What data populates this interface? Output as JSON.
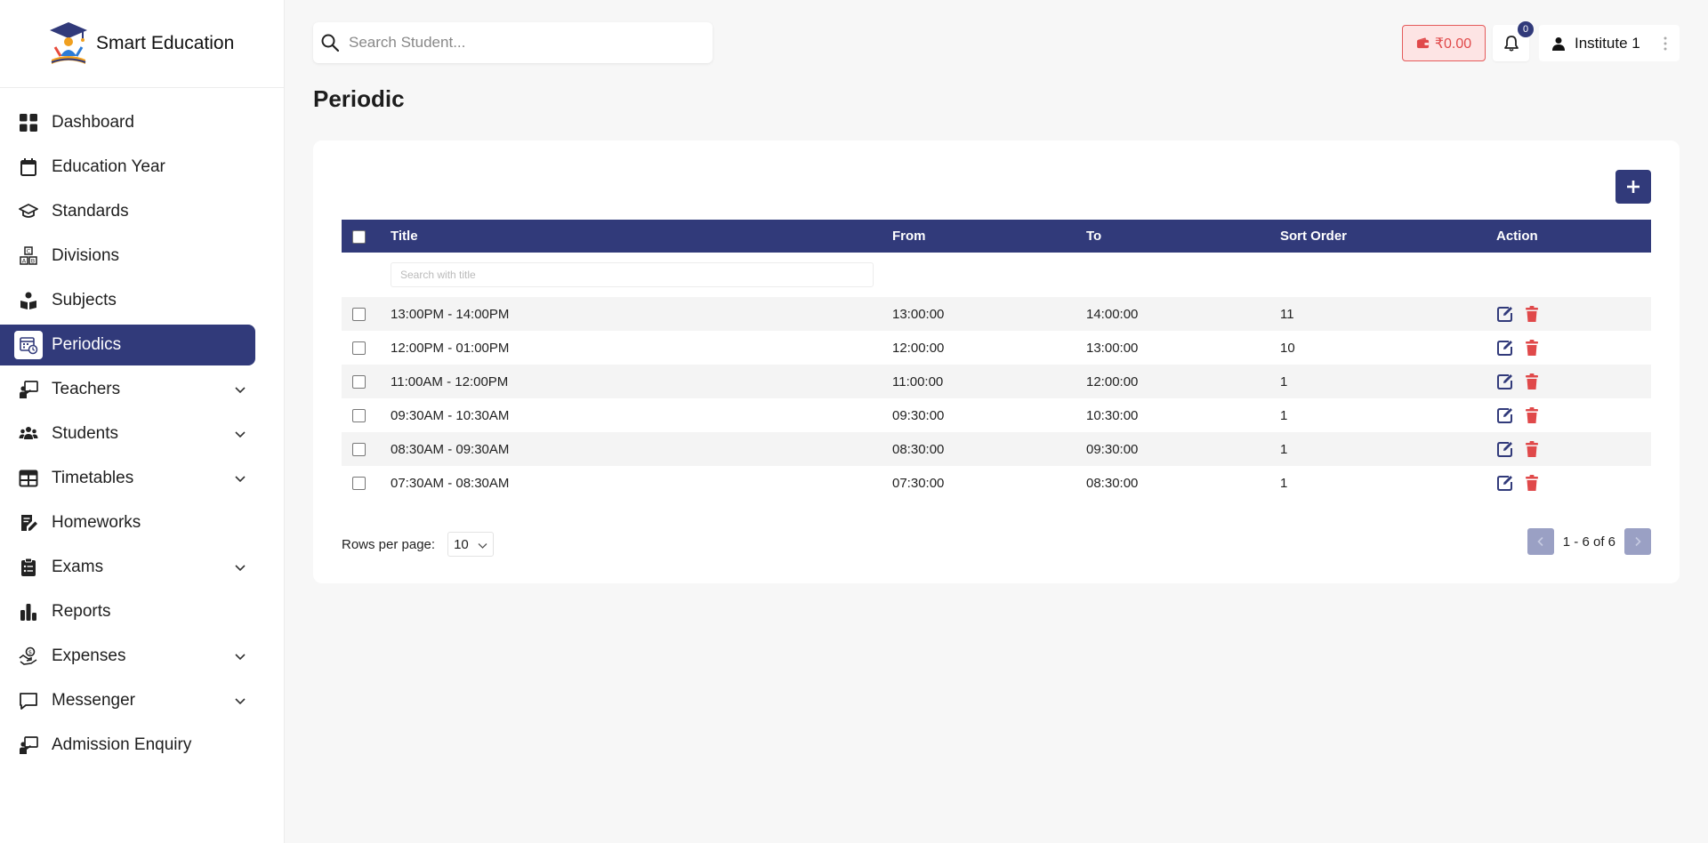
{
  "brand": {
    "name": "Smart Education"
  },
  "sidebar": {
    "items": [
      {
        "label": "Dashboard",
        "icon": "dashboard-icon",
        "expandable": false,
        "active": false
      },
      {
        "label": "Education Year",
        "icon": "calendar-icon",
        "expandable": false,
        "active": false
      },
      {
        "label": "Standards",
        "icon": "graduation-cap-icon",
        "expandable": false,
        "active": false
      },
      {
        "label": "Divisions",
        "icon": "abc-blocks-icon",
        "expandable": false,
        "active": false
      },
      {
        "label": "Subjects",
        "icon": "subject-reader-icon",
        "expandable": false,
        "active": false
      },
      {
        "label": "Periodics",
        "icon": "calendar-clock-icon",
        "expandable": false,
        "active": true
      },
      {
        "label": "Teachers",
        "icon": "teacher-board-icon",
        "expandable": true,
        "active": false
      },
      {
        "label": "Students",
        "icon": "users-icon",
        "expandable": true,
        "active": false
      },
      {
        "label": "Timetables",
        "icon": "table-icon",
        "expandable": true,
        "active": false
      },
      {
        "label": "Homeworks",
        "icon": "edit-document-icon",
        "expandable": false,
        "active": false
      },
      {
        "label": "Exams",
        "icon": "clipboard-list-icon",
        "expandable": true,
        "active": false
      },
      {
        "label": "Reports",
        "icon": "bar-chart-icon",
        "expandable": false,
        "active": false
      },
      {
        "label": "Expenses",
        "icon": "hand-money-icon",
        "expandable": true,
        "active": false
      },
      {
        "label": "Messenger",
        "icon": "message-icon",
        "expandable": true,
        "active": false
      },
      {
        "label": "Admission Enquiry",
        "icon": "teacher-board-icon",
        "expandable": false,
        "active": false
      }
    ]
  },
  "topbar": {
    "search_placeholder": "Search Student...",
    "wallet_amount": "₹0.00",
    "notification_count": "0",
    "user_name": "Institute 1"
  },
  "page": {
    "title": "Periodic"
  },
  "table": {
    "columns": [
      "Title",
      "From",
      "To",
      "Sort Order",
      "Action"
    ],
    "filter_placeholder": "Search with title",
    "rows": [
      {
        "title": "13:00PM - 14:00PM",
        "from": "13:00:00",
        "to": "14:00:00",
        "sort": "11"
      },
      {
        "title": "12:00PM - 01:00PM",
        "from": "12:00:00",
        "to": "13:00:00",
        "sort": "10"
      },
      {
        "title": "11:00AM - 12:00PM",
        "from": "11:00:00",
        "to": "12:00:00",
        "sort": "1"
      },
      {
        "title": "09:30AM - 10:30AM",
        "from": "09:30:00",
        "to": "10:30:00",
        "sort": "1"
      },
      {
        "title": "08:30AM - 09:30AM",
        "from": "08:30:00",
        "to": "09:30:00",
        "sort": "1"
      },
      {
        "title": "07:30AM - 08:30AM",
        "from": "07:30:00",
        "to": "08:30:00",
        "sort": "1"
      }
    ]
  },
  "pagination": {
    "rows_per_page_label": "Rows per page:",
    "rows_per_page_value": "10",
    "range_text": "1 - 6 of 6"
  },
  "colors": {
    "primary": "#313a7a",
    "danger": "#e0494a",
    "background": "#f7f7f7"
  }
}
